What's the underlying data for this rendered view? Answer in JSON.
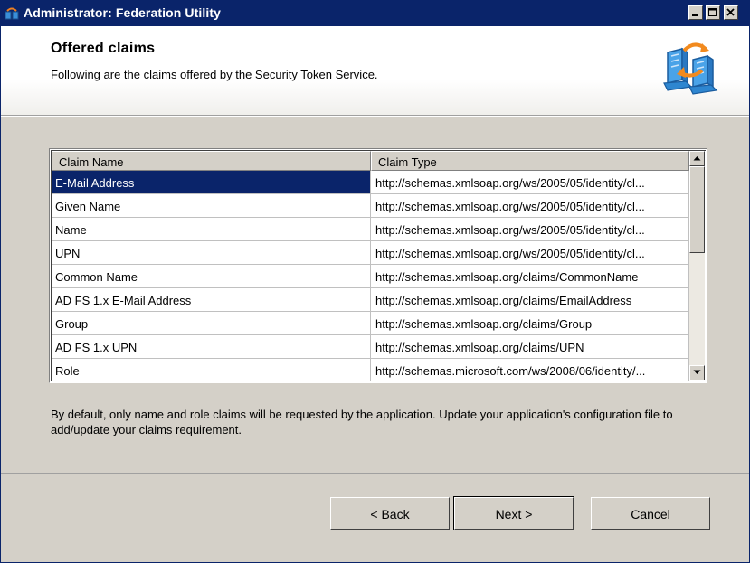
{
  "window": {
    "title": "Administrator: Federation Utility",
    "colors": {
      "titlebar": "#0a246a",
      "selection": "#0a246a",
      "face": "#d4d0c8"
    }
  },
  "title_icons": [
    "app-icon",
    "minimize-icon",
    "maximize-icon",
    "close-icon"
  ],
  "header": {
    "title": "Offered claims",
    "subtitle": "Following are the claims offered by the Security Token Service.",
    "icon": "federation-servers-icon"
  },
  "claims_table": {
    "columns": [
      "Claim Name",
      "Claim Type"
    ],
    "selected_index": 0,
    "rows": [
      {
        "name": "E-Mail Address",
        "type": "http://schemas.xmlsoap.org/ws/2005/05/identity/cl..."
      },
      {
        "name": "Given Name",
        "type": "http://schemas.xmlsoap.org/ws/2005/05/identity/cl..."
      },
      {
        "name": "Name",
        "type": "http://schemas.xmlsoap.org/ws/2005/05/identity/cl..."
      },
      {
        "name": "UPN",
        "type": "http://schemas.xmlsoap.org/ws/2005/05/identity/cl..."
      },
      {
        "name": "Common Name",
        "type": "http://schemas.xmlsoap.org/claims/CommonName"
      },
      {
        "name": "AD FS 1.x E-Mail Address",
        "type": "http://schemas.xmlsoap.org/claims/EmailAddress"
      },
      {
        "name": "Group",
        "type": "http://schemas.xmlsoap.org/claims/Group"
      },
      {
        "name": "AD FS 1.x UPN",
        "type": "http://schemas.xmlsoap.org/claims/UPN"
      },
      {
        "name": "Role",
        "type": "http://schemas.microsoft.com/ws/2008/06/identity/..."
      }
    ]
  },
  "description": "By default, only name and role claims will be requested by the application. Update your application's configuration file to add/update your claims requirement.",
  "buttons": {
    "back": "< Back",
    "next": "Next >",
    "cancel": "Cancel"
  }
}
